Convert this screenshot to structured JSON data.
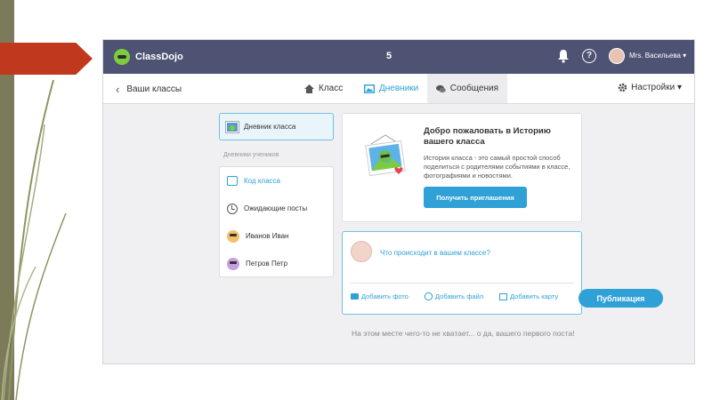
{
  "colors": {
    "topbar": "#4e5273",
    "accent": "#2fa1d6",
    "slide_arrow": "#c0391f"
  },
  "topbar": {
    "app_name": "ClassDojo",
    "class_count": "5",
    "help_glyph": "?",
    "user_name": "Mrs. Васильева ▾",
    "icons": [
      "bell-icon",
      "help-icon",
      "avatar"
    ]
  },
  "nav": {
    "back_label": "Ваши классы",
    "tabs": [
      {
        "label": "Класс",
        "icon": "home-icon"
      },
      {
        "label": "Дневники",
        "icon": "photo-icon",
        "active": true
      },
      {
        "label": "Сообщения",
        "icon": "chat-icon"
      }
    ],
    "settings_label": "Настройки ▾"
  },
  "sidebar": {
    "class_story_label": "Дневник класса",
    "section_label": "Дневники учеников",
    "items": [
      {
        "label": "Код класса",
        "icon": "code-icon",
        "active": true
      },
      {
        "label": "Ожидающие посты",
        "icon": "clock-icon"
      },
      {
        "label": "Иванов Иван",
        "icon": "monster-avatar"
      },
      {
        "label": "Петров Петр",
        "icon": "monster-avatar"
      }
    ]
  },
  "welcome": {
    "title": "Добро пожаловать в Историю вашего класса",
    "description": "История класса - это самый простой способ поделиться с родителями событиями в классе, фотографиями и новостями.",
    "button_label": "Получить приглашения"
  },
  "composer": {
    "placeholder": "Что происходит в вашем классе?",
    "actions": [
      "Добавить фото",
      "Добавить файл",
      "Добавить карту"
    ],
    "publish_label": "Публикация"
  },
  "empty_message": "На этом месте чего-то не хватает... о да, вашего первого поста!"
}
